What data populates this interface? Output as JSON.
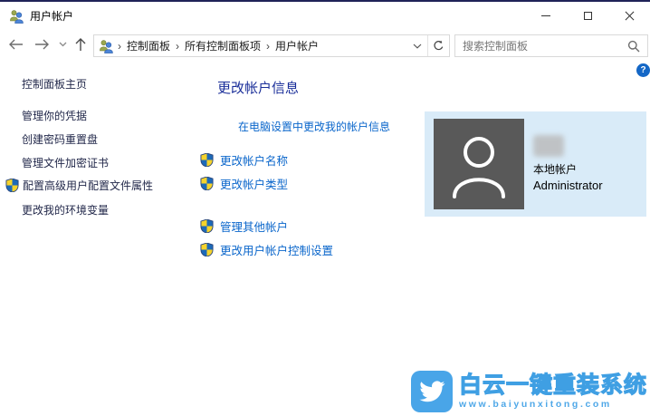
{
  "window": {
    "title": "用户帐户"
  },
  "navbar": {
    "breadcrumb": {
      "separator": "›",
      "items": [
        {
          "label": "控制面板"
        },
        {
          "label": "所有控制面板项"
        },
        {
          "label": "用户帐户"
        }
      ]
    },
    "search": {
      "placeholder": "搜索控制面板"
    }
  },
  "help": {
    "label": "?"
  },
  "sidebar": {
    "home": "控制面板主页",
    "tasks": [
      {
        "label": "管理你的凭据"
      },
      {
        "label": "创建密码重置盘"
      },
      {
        "label": "管理文件加密证书"
      },
      {
        "label": "配置高级用户配置文件属性"
      },
      {
        "label": "更改我的环境变量"
      }
    ]
  },
  "main": {
    "heading": "更改帐户信息",
    "pc_settings_link": "在电脑设置中更改我的帐户信息",
    "tasks": [
      {
        "label": "更改帐户名称"
      },
      {
        "label": "更改帐户类型"
      },
      {
        "label": "管理其他帐户"
      },
      {
        "label": "更改用户帐户控制设置"
      }
    ],
    "account_panel": {
      "account_type": "本地帐户",
      "account_name": "Administrator"
    }
  },
  "watermark": {
    "title": "白云一键重装系统",
    "url": "www.baiyunxitong.com"
  },
  "colors": {
    "link_blue": "#0a66cb",
    "heading_blue": "#1a2e99",
    "panel_bg": "#d9ebf8",
    "avatar_bg": "#595959",
    "watermark_blue": "#49a5e8",
    "shield_yellow": "#f6d32b",
    "shield_blue": "#1d6ab8"
  }
}
